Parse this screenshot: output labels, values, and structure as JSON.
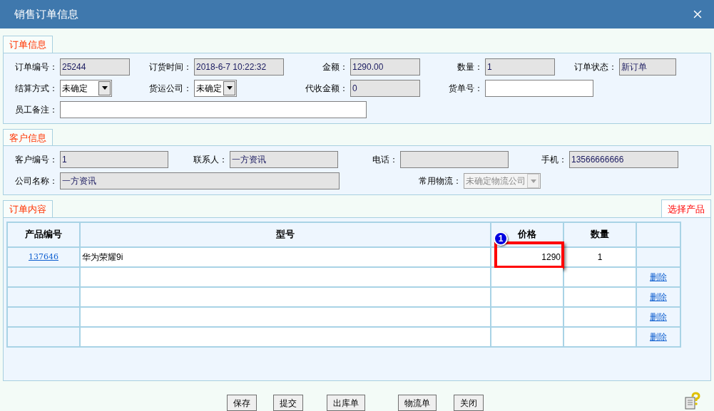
{
  "window": {
    "title": "销售订单信息"
  },
  "order_info": {
    "tab": "订单信息",
    "rows": [
      [
        {
          "label": "订单编号：",
          "value": "25244",
          "kind": "readonly"
        },
        {
          "label": "订货时间：",
          "value": "2018-6-7 10:22:32",
          "kind": "readonly"
        },
        {
          "label": "金额：",
          "value": "1290.00",
          "kind": "readonly"
        },
        {
          "label": "数量：",
          "value": "1",
          "kind": "readonly"
        },
        {
          "label": "订单状态：",
          "value": "新订单",
          "kind": "readonly"
        }
      ],
      [
        {
          "label": "结算方式：",
          "value": "未确定",
          "kind": "select"
        },
        {
          "label": "货运公司：",
          "value": "未确定",
          "kind": "select"
        },
        {
          "label": "代收金额：",
          "value": "0",
          "kind": "readonly"
        },
        {
          "label": "货单号：",
          "kind": "input"
        }
      ],
      [
        {
          "label": "员工备注：",
          "kind": "input"
        }
      ]
    ]
  },
  "customer_info": {
    "tab": "客户信息",
    "rows": [
      [
        {
          "label": "客户编号：",
          "value": "1",
          "kind": "readonly"
        },
        {
          "label": "联系人：",
          "value": "一方资讯",
          "kind": "readonly"
        },
        {
          "label": "电话：",
          "kind": "readonly"
        },
        {
          "label": "手机：",
          "value": "13566666666",
          "kind": "readonly"
        }
      ],
      [
        {
          "label": "公司名称：",
          "value": "一方资讯",
          "kind": "readonly"
        },
        {
          "label": "常用物流：",
          "value": "未确定物流公司",
          "kind": "select_disabled"
        }
      ]
    ]
  },
  "order_items": {
    "tab": "订单内容",
    "select_product": "选择产品",
    "columns": [
      "产品编号",
      "型号",
      "价格",
      "数量"
    ],
    "rows": [
      {
        "product_no": "137646",
        "model": "华为荣耀9i",
        "price": "1290",
        "quantity": "1",
        "highlighted": true
      },
      {
        "action": "删除",
        "highlighted": false
      },
      {
        "action": "删除",
        "highlighted": false
      },
      {
        "action": "删除",
        "highlighted": false
      },
      {
        "action": "删除",
        "highlighted": false
      }
    ],
    "annotation_badge": "1"
  },
  "buttons": [
    "保存",
    "提交",
    "出库单",
    "物流单",
    "关闭"
  ]
}
